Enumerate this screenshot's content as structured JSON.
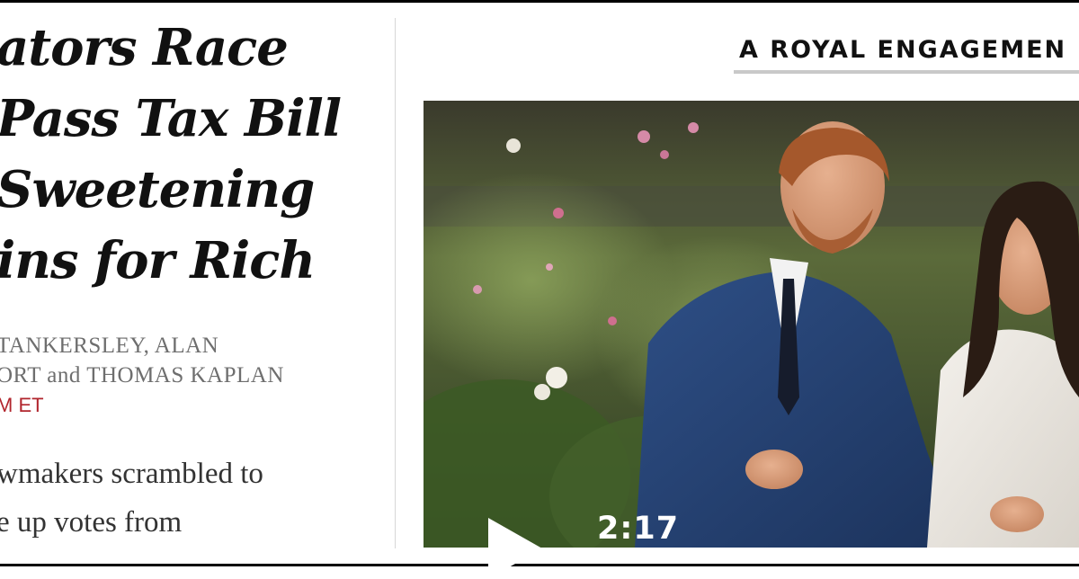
{
  "story": {
    "headline_lines": [
      "ators Race",
      "Pass Tax Bill",
      "Sweetening",
      "ins for Rich"
    ],
    "byline_lines": [
      "TANKERSLEY, ALAN",
      "ORT and THOMAS KAPLAN"
    ],
    "timestamp": "M ET",
    "summary_lines": [
      "wmakers scrambled to",
      "e up votes from"
    ]
  },
  "feature": {
    "kicker": "A ROYAL ENGAGEMEN",
    "video_duration": "2:17",
    "play_icon": "play-icon"
  },
  "colors": {
    "timestamp": "#b1252d",
    "kicker_rule": "#c9c9c9",
    "border": "#000000"
  }
}
